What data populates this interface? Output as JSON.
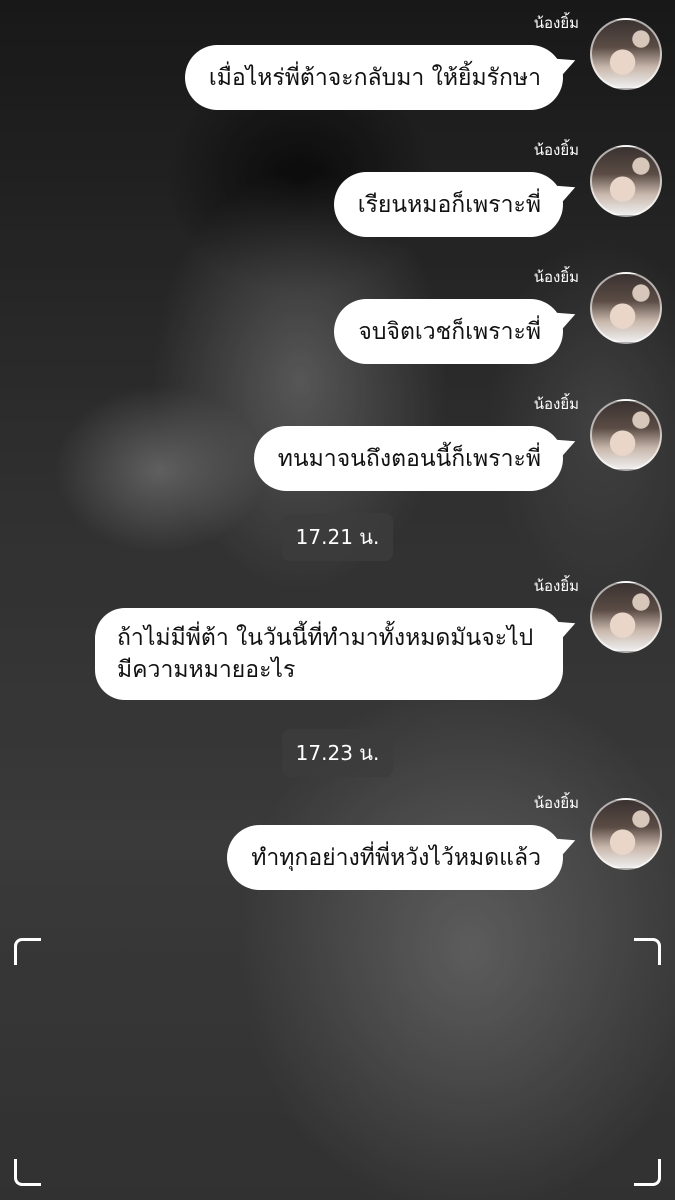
{
  "chat": {
    "sender_name": "น้องยิ้ม",
    "messages": [
      {
        "text": "เมื่อไหร่พี่ต้าจะกลับมา ให้ยิ้มรักษา"
      },
      {
        "text": "เรียนหมอก็เพราะพี่"
      },
      {
        "text": "จบจิตเวชก็เพราะพี่"
      },
      {
        "text": "ทนมาจนถึงตอนนี้ก็เพราะพี่"
      },
      {
        "time": "17.21 น."
      },
      {
        "text": "ถ้าไม่มีพี่ต้า ในวันนี้ที่ทำมาทั้งหมดมันจะไปมีความหมายอะไร"
      },
      {
        "time": "17.23 น."
      },
      {
        "text": "ทำทุกอย่างที่พี่หวังไว้หมดแล้ว"
      }
    ]
  },
  "icons": {
    "avatar": "profile-photo-avatar",
    "frame_corners": "viewfinder-corner-icon"
  }
}
